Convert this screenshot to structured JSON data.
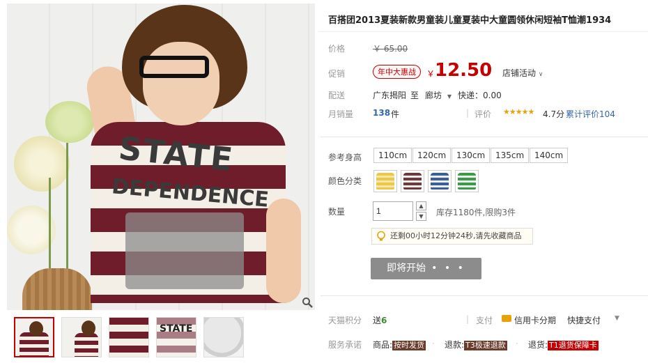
{
  "product": {
    "title": "百搭团2013夏装新款男童装儿童夏装中大童圆领休闲短袖T恤潮1934"
  },
  "price": {
    "label": "价格",
    "original": "￥ 65.00"
  },
  "promo": {
    "label": "促销",
    "badge": "年中大惠战",
    "yen": "￥",
    "value": "12.50",
    "shop_activity": "店铺活动"
  },
  "shipping": {
    "label": "配送",
    "from": "广东揭阳",
    "to_word": "至",
    "destination": "廊坊",
    "express": "快递：0.00"
  },
  "sales": {
    "label": "月销量",
    "count": "138",
    "unit": "件",
    "rating_label": "评价",
    "stars_glyphs": "★★★★★",
    "rating": "4.7分",
    "review_count": "累计评价104"
  },
  "sizes": {
    "label": "参考身高",
    "options": [
      "110cm",
      "120cm",
      "130cm",
      "135cm",
      "140cm"
    ]
  },
  "colors": {
    "label": "颜色分类",
    "swatches": [
      "#e9c84a",
      "#6b3a3a",
      "#3b5f94",
      "#3a9a4a"
    ]
  },
  "quantity": {
    "label": "数量",
    "value": "1",
    "stock": "库存1180件,限购3件"
  },
  "tip": {
    "text": "还剩00小时12分钟24秒,请先收藏商品"
  },
  "buy": {
    "label": "即将开始",
    "dots": "• • •"
  },
  "points": {
    "label": "天猫积分",
    "send": "送",
    "value": "6",
    "pay_label": "支付",
    "credit": "信用卡分期",
    "quick": "快捷支付"
  },
  "service": {
    "label": "服务承诺",
    "goods": "商品:",
    "goods_tag": "按时发货",
    "refund": "退款:",
    "refund_tag": "T3极速退款",
    "return": "退货:",
    "return_tag": "T1退货保障卡"
  },
  "photo": {
    "print_line1": "STATE",
    "print_line2": "DEPENDENCE",
    "thumb_text": "STATE"
  }
}
